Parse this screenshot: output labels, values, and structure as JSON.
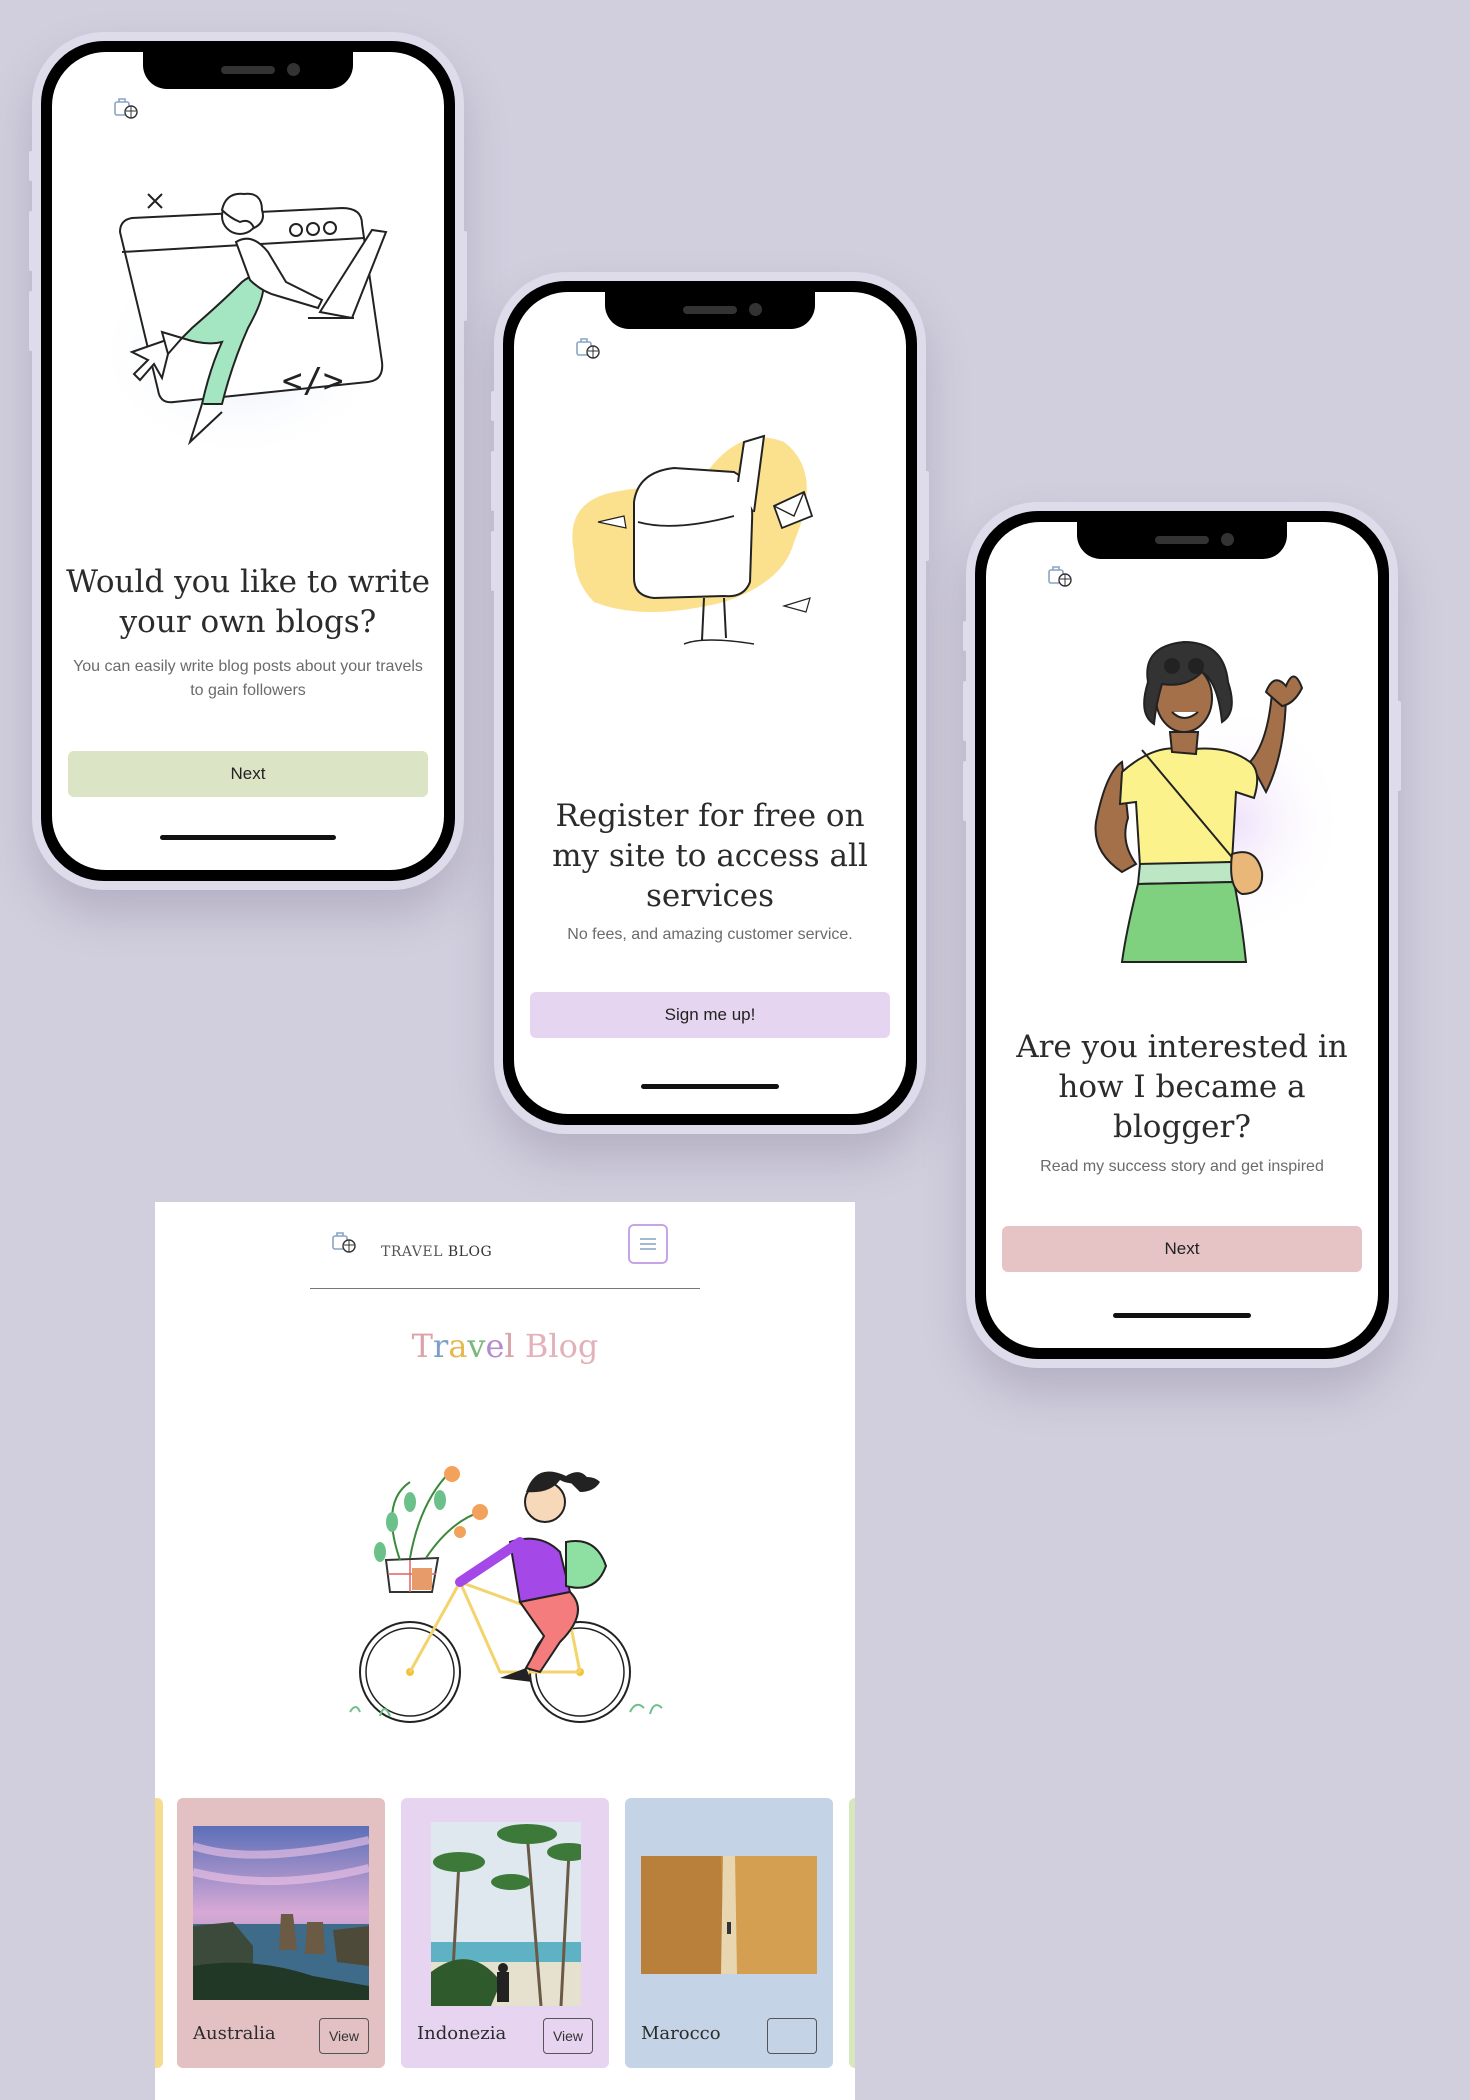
{
  "screens": [
    {
      "title": "Would you like to write your own blogs?",
      "subtitle": "You can easily write blog posts about your travels to gain followers",
      "button": "Next",
      "button_color": "#dbe5c6"
    },
    {
      "title": "Register for free on my site to access all services",
      "subtitle": "No fees, and amazing customer service.",
      "button": "Sign me up!",
      "button_color": "#e6d5f0"
    },
    {
      "title": "Are you interested in how I became a blogger?",
      "subtitle": "Read my success story and get inspired",
      "button": "Next",
      "button_color": "#e6c3c5"
    }
  ],
  "site": {
    "brand_first": "TRAVEL",
    "brand_second": "BLOG",
    "menu_icon": "hamburger-menu-icon",
    "title_letters": [
      {
        "ch": "T",
        "color": "#d9a3a8"
      },
      {
        "ch": "r",
        "color": "#7aa0c8"
      },
      {
        "ch": "a",
        "color": "#e6b84e"
      },
      {
        "ch": "v",
        "color": "#7db77d"
      },
      {
        "ch": "e",
        "color": "#b58bd0"
      },
      {
        "ch": "l",
        "color": "#d9a3a8"
      },
      {
        "ch": " ",
        "color": "#ffffff"
      },
      {
        "ch": "B",
        "color": "#e3b1b8"
      },
      {
        "ch": "l",
        "color": "#e3b1b8"
      },
      {
        "ch": "o",
        "color": "#e3b1b8"
      },
      {
        "ch": "g",
        "color": "#e3b1b8"
      }
    ],
    "cards": [
      {
        "name": "Australia",
        "view": "View",
        "color": "#e3c1c3"
      },
      {
        "name": "Indonezia",
        "view": "View",
        "color": "#e6d4f0"
      },
      {
        "name": "Marocco",
        "view": "",
        "color": "#c4d4e6"
      }
    ],
    "edge_colors": [
      "#f5dc8f",
      "#d7e6bd"
    ]
  }
}
